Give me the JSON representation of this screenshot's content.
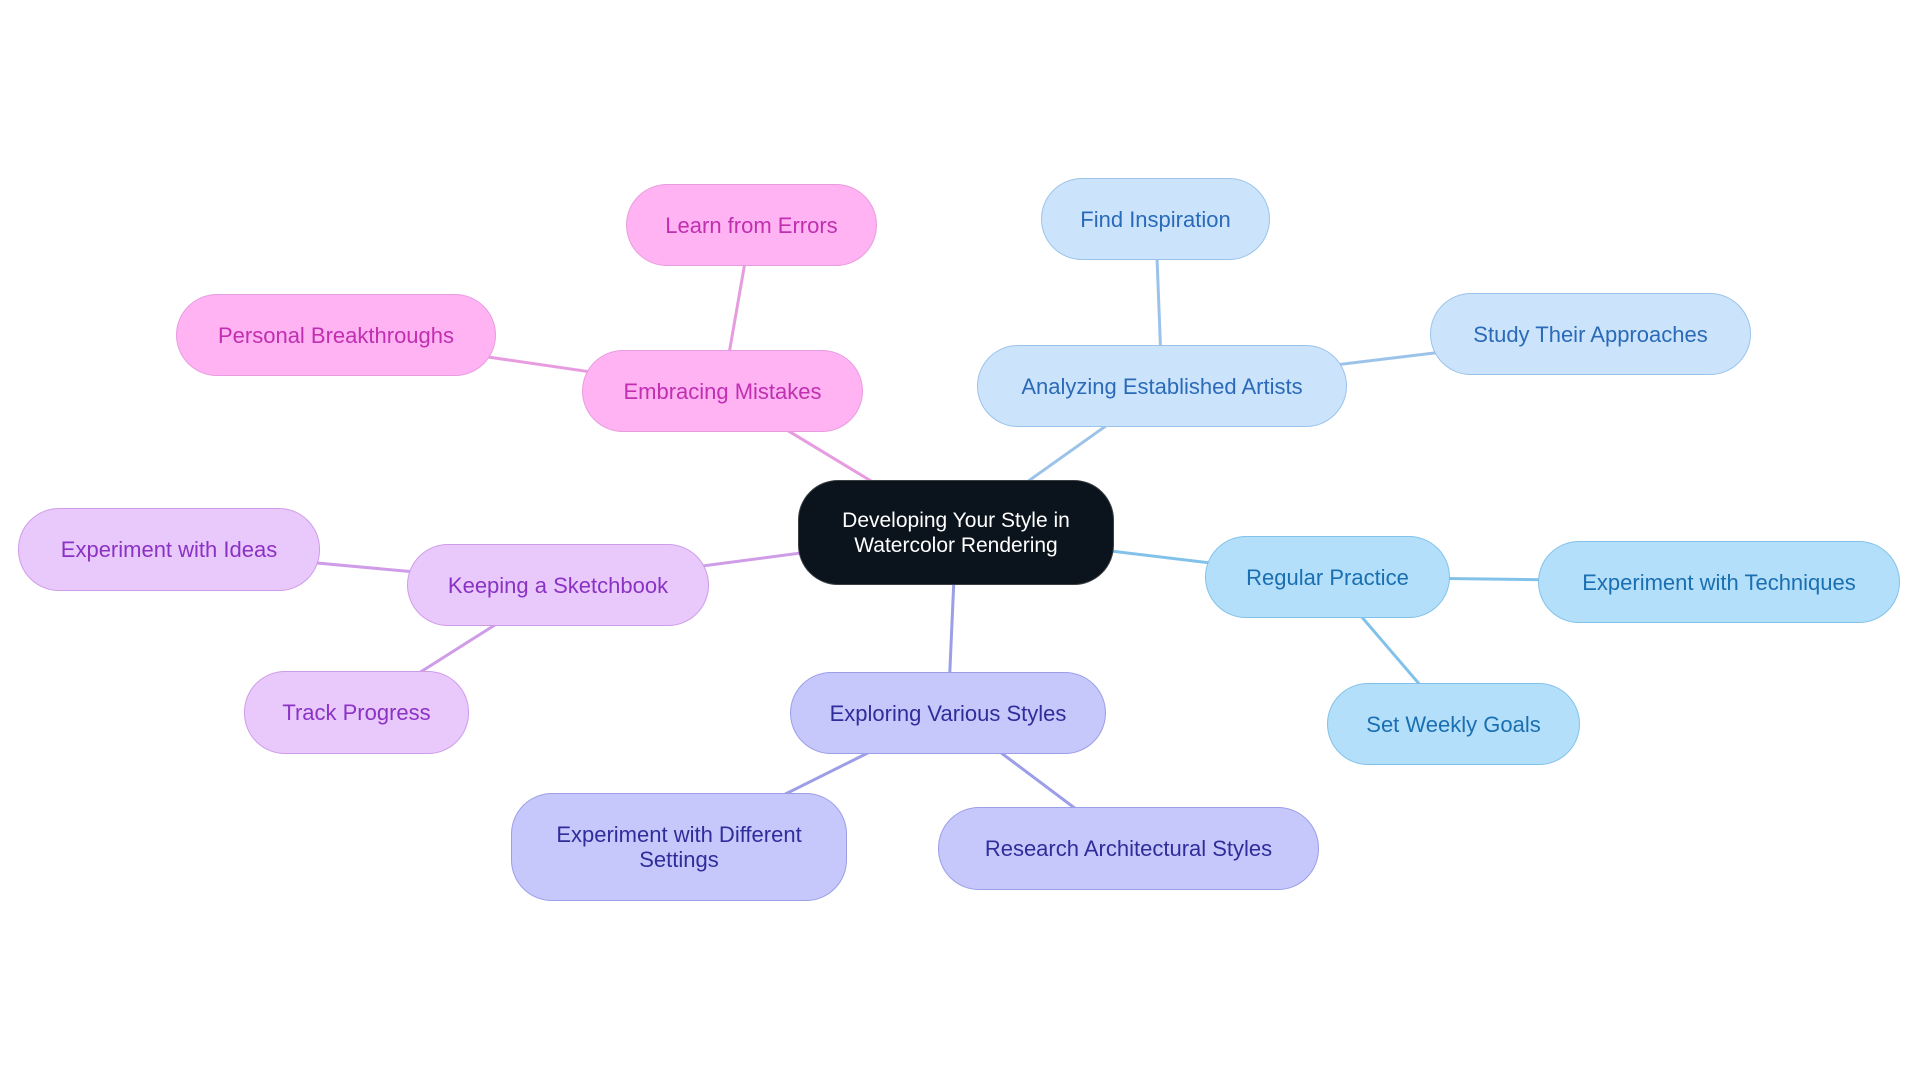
{
  "diagram": {
    "type": "mindmap",
    "root": {
      "id": "root",
      "label": "Developing Your Style in\nWatercolor Rendering"
    },
    "branches": [
      {
        "id": "embracing",
        "label": "Embracing Mistakes",
        "theme": "pink",
        "color": "#e89ce0",
        "children": [
          {
            "id": "learn",
            "label": "Learn from Errors"
          },
          {
            "id": "breakthroughs",
            "label": "Personal Breakthroughs"
          }
        ]
      },
      {
        "id": "analyzing",
        "label": "Analyzing Established Artists",
        "theme": "blue",
        "color": "#9bc3ea",
        "children": [
          {
            "id": "inspiration",
            "label": "Find Inspiration"
          },
          {
            "id": "approaches",
            "label": "Study Their Approaches"
          }
        ]
      },
      {
        "id": "practice",
        "label": "Regular Practice",
        "theme": "sky",
        "color": "#82c2ea",
        "children": [
          {
            "id": "techniques",
            "label": "Experiment with Techniques"
          },
          {
            "id": "goals",
            "label": "Set Weekly Goals"
          }
        ]
      },
      {
        "id": "sketchbook",
        "label": "Keeping a Sketchbook",
        "theme": "lavender",
        "color": "#cf9ce8",
        "children": [
          {
            "id": "ideas",
            "label": "Experiment with Ideas"
          },
          {
            "id": "progress",
            "label": "Track Progress"
          }
        ]
      },
      {
        "id": "styles",
        "label": "Exploring Various Styles",
        "theme": "periwinkle",
        "color": "#9c9ee8",
        "children": [
          {
            "id": "settings",
            "label": "Experiment with Different\nSettings"
          },
          {
            "id": "architectural",
            "label": "Research Architectural Styles"
          }
        ]
      }
    ]
  }
}
